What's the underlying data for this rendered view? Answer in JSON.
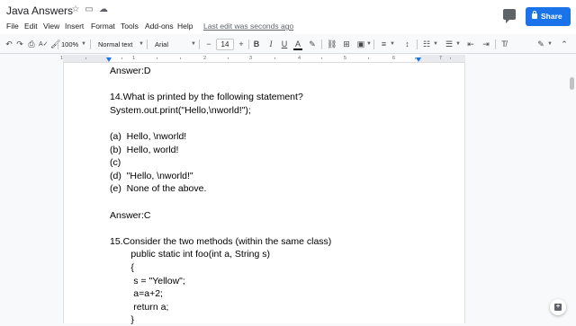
{
  "app": {
    "doc_title": "Java Answers",
    "last_edit": "Last edit was seconds ago",
    "share_label": "Share"
  },
  "menu": [
    "File",
    "Edit",
    "View",
    "Insert",
    "Format",
    "Tools",
    "Add-ons",
    "Help"
  ],
  "toolbar": {
    "zoom": "100%",
    "style": "Normal text",
    "font": "Arial",
    "font_size": "14",
    "icons": [
      "undo-icon",
      "redo-icon",
      "print-icon",
      "spellcheck-icon",
      "paint-format-icon",
      "bold-icon",
      "italic-icon",
      "underline-icon",
      "text-color-icon",
      "highlight-icon",
      "link-icon",
      "comment-add-icon",
      "image-icon",
      "align-icon",
      "line-spacing-icon",
      "numbered-list-icon",
      "bulleted-list-icon",
      "decrease-indent-icon",
      "increase-indent-icon",
      "clear-format-icon",
      "editing-mode-icon",
      "collapse-icon"
    ]
  },
  "ruler": {
    "numbers": [
      "1",
      "1",
      "2",
      "3",
      "4",
      "5",
      "6",
      "7"
    ]
  },
  "document": {
    "lines": [
      "Answer:D",
      "",
      "14.What is printed by the following statement?",
      "System.out.print(\"Hello,\\nworld!\");",
      "",
      "(a)  Hello, \\nworld!",
      "(b)  Hello, world!",
      "(c)",
      "(d)  \"Hello, \\nworld!\"",
      "(e)  None of the above.",
      "",
      "Answer:C",
      "",
      "15.Consider the two methods (within the same class)",
      "        public static int foo(int a, String s)",
      "        {",
      "         s = \"Yellow\";",
      "         a=a+2;",
      "         return a;",
      "        }"
    ]
  },
  "colors": {
    "accent": "#1a73e8",
    "text": "#000000",
    "toolbar_bg": "#f8f9fa"
  }
}
